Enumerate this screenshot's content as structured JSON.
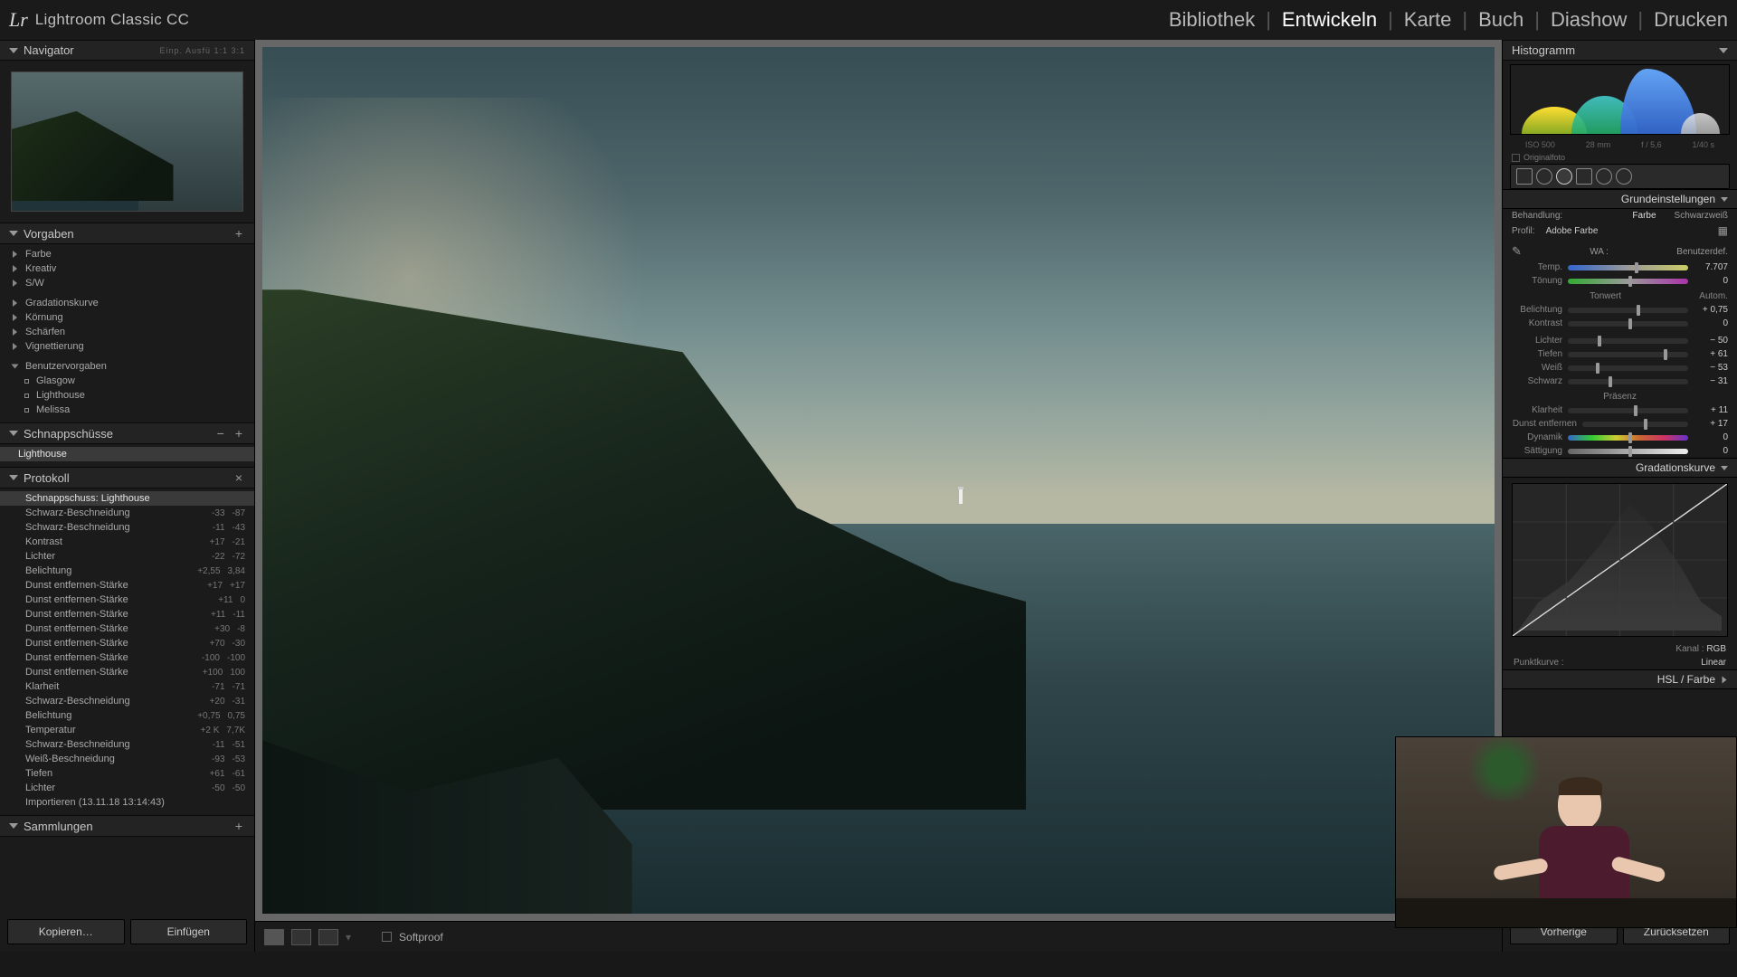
{
  "app": {
    "title": "Lightroom Classic CC",
    "logo": "Lr"
  },
  "topnav": {
    "items": [
      "Bibliothek",
      "Entwickeln",
      "Karte",
      "Buch",
      "Diashow",
      "Drucken"
    ],
    "active": "Entwickeln"
  },
  "navigator": {
    "title": "Navigator",
    "zoom_info": "Einp.   Ausfü   1:1    3:1"
  },
  "presets": {
    "title": "Vorgaben",
    "groups": [
      "Farbe",
      "Kreativ",
      "S/W"
    ],
    "groups2": [
      "Gradationskurve",
      "Körnung",
      "Schärfen",
      "Vignettierung"
    ],
    "user_header": "Benutzervorgaben",
    "user_items": [
      "Glasgow",
      "Lighthouse",
      "Melissa"
    ]
  },
  "snapshots": {
    "title": "Schnappschüsse",
    "items": [
      "Lighthouse"
    ],
    "selected": 0
  },
  "history": {
    "title": "Protokoll",
    "items": [
      {
        "label": "Schnappschuss: Lighthouse",
        "a": "",
        "b": ""
      },
      {
        "label": "Schwarz-Beschneidung",
        "a": "-33",
        "b": "-87"
      },
      {
        "label": "Schwarz-Beschneidung",
        "a": "-11",
        "b": "-43"
      },
      {
        "label": "Kontrast",
        "a": "+17",
        "b": "-21"
      },
      {
        "label": "Lichter",
        "a": "-22",
        "b": "-72"
      },
      {
        "label": "Belichtung",
        "a": "+2,55",
        "b": "3,84"
      },
      {
        "label": "Dunst entfernen-Stärke",
        "a": "+17",
        "b": "+17"
      },
      {
        "label": "Dunst entfernen-Stärke",
        "a": "+11",
        "b": "0"
      },
      {
        "label": "Dunst entfernen-Stärke",
        "a": "+11",
        "b": "-11"
      },
      {
        "label": "Dunst entfernen-Stärke",
        "a": "+30",
        "b": "-8"
      },
      {
        "label": "Dunst entfernen-Stärke",
        "a": "+70",
        "b": "-30"
      },
      {
        "label": "Dunst entfernen-Stärke",
        "a": "-100",
        "b": "-100"
      },
      {
        "label": "Dunst entfernen-Stärke",
        "a": "+100",
        "b": "100"
      },
      {
        "label": "Klarheit",
        "a": "-71",
        "b": "-71"
      },
      {
        "label": "Schwarz-Beschneidung",
        "a": "+20",
        "b": "-31"
      },
      {
        "label": "Belichtung",
        "a": "+0,75",
        "b": "0,75"
      },
      {
        "label": "Temperatur",
        "a": "+2 K",
        "b": "7,7K"
      },
      {
        "label": "Schwarz-Beschneidung",
        "a": "-11",
        "b": "-51"
      },
      {
        "label": "Weiß-Beschneidung",
        "a": "-93",
        "b": "-53"
      },
      {
        "label": "Tiefen",
        "a": "+61",
        "b": "-61"
      },
      {
        "label": "Lichter",
        "a": "-50",
        "b": "-50"
      },
      {
        "label": "Importieren (13.11.18 13:14:43)",
        "a": "",
        "b": ""
      }
    ],
    "selected": 0
  },
  "collections": {
    "title": "Sammlungen"
  },
  "left_buttons": {
    "copy": "Kopieren…",
    "paste": "Einfügen"
  },
  "toolbar": {
    "softproof": "Softproof"
  },
  "histogram": {
    "title": "Histogramm",
    "meta": {
      "iso": "ISO 500",
      "focal": "28 mm",
      "aperture": "f / 5,6",
      "shutter": "1/40 s"
    },
    "orig": "Originalfoto"
  },
  "basic": {
    "title": "Grundeinstellungen",
    "treatment_label": "Behandlung:",
    "treatment_color": "Farbe",
    "treatment_bw": "Schwarzweiß",
    "profile_label": "Profil:",
    "profile_value": "Adobe Farbe",
    "wb_label": "WA :",
    "wb_value": "Benutzerdef.",
    "temp": {
      "label": "Temp.",
      "value": "7.707"
    },
    "tint": {
      "label": "Tönung",
      "value": "0"
    },
    "tone_header": "Tonwert",
    "auto": "Autom.",
    "exposure": {
      "label": "Belichtung",
      "value": "+ 0,75"
    },
    "contrast": {
      "label": "Kontrast",
      "value": "0"
    },
    "highlights": {
      "label": "Lichter",
      "value": "− 50"
    },
    "shadows": {
      "label": "Tiefen",
      "value": "+ 61"
    },
    "whites": {
      "label": "Weiß",
      "value": "− 53"
    },
    "blacks": {
      "label": "Schwarz",
      "value": "− 31"
    },
    "presence_header": "Präsenz",
    "clarity": {
      "label": "Klarheit",
      "value": "+ 11"
    },
    "dehaze": {
      "label": "Dunst entfernen",
      "value": "+ 17"
    },
    "vibrance": {
      "label": "Dynamik",
      "value": "0"
    },
    "saturation": {
      "label": "Sättigung",
      "value": "0"
    }
  },
  "tonecurve": {
    "title": "Gradationskurve",
    "channel_label": "Kanal :",
    "channel_value": "RGB",
    "point_label": "Punktkurve :",
    "point_value": "Linear"
  },
  "hsl": {
    "title": "HSL / Farbe"
  },
  "right_buttons": {
    "prev": "Vorherige",
    "reset": "Zurücksetzen"
  }
}
